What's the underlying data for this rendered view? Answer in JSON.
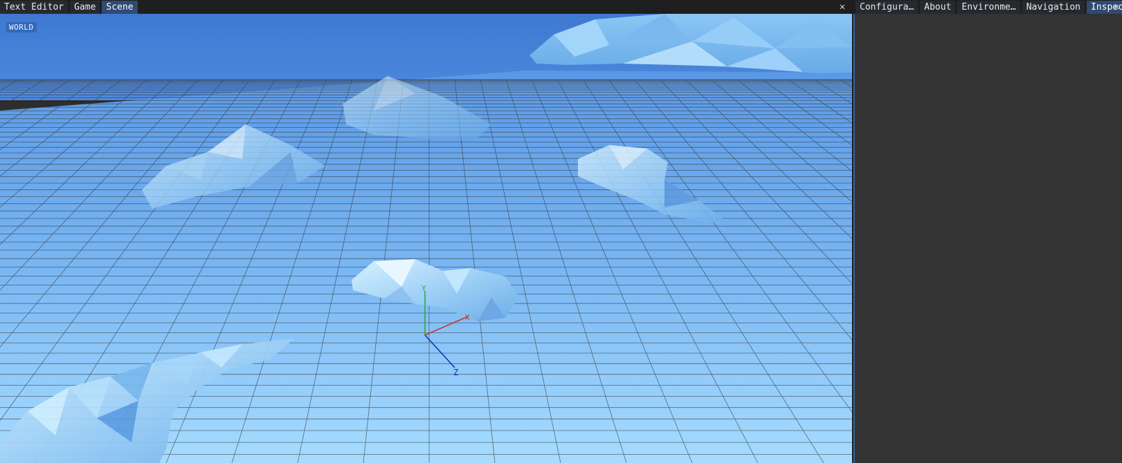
{
  "left_tabs": [
    {
      "label": "Text Editor",
      "active": false
    },
    {
      "label": "Game",
      "active": false
    },
    {
      "label": "Scene",
      "active": true
    }
  ],
  "right_tabs": [
    {
      "label": "Configura…",
      "active": false
    },
    {
      "label": "About",
      "active": false
    },
    {
      "label": "Environme…",
      "active": false
    },
    {
      "label": "Navigation",
      "active": false
    },
    {
      "label": "Inspector",
      "active": true
    }
  ],
  "close_glyph": "✕",
  "viewport": {
    "overlay_label": "WORLD",
    "gizmo": {
      "x_label": "X",
      "y_label": "Y",
      "z_label": "Z",
      "x_color": "#c0392b",
      "y_color": "#27ae3f",
      "z_color": "#1a2fb8"
    },
    "sky_color_top": "#3f78d0",
    "ground_color_far": "#5a98e6",
    "ground_color_near": "#9fd6ff",
    "grid_color": "#3a3a3a"
  },
  "colors": {
    "active_tab": "#2f4a73",
    "inactive_tab": "#262a30",
    "panel_bg": "#333333",
    "tabbar_bg": "#1e1e1e"
  }
}
